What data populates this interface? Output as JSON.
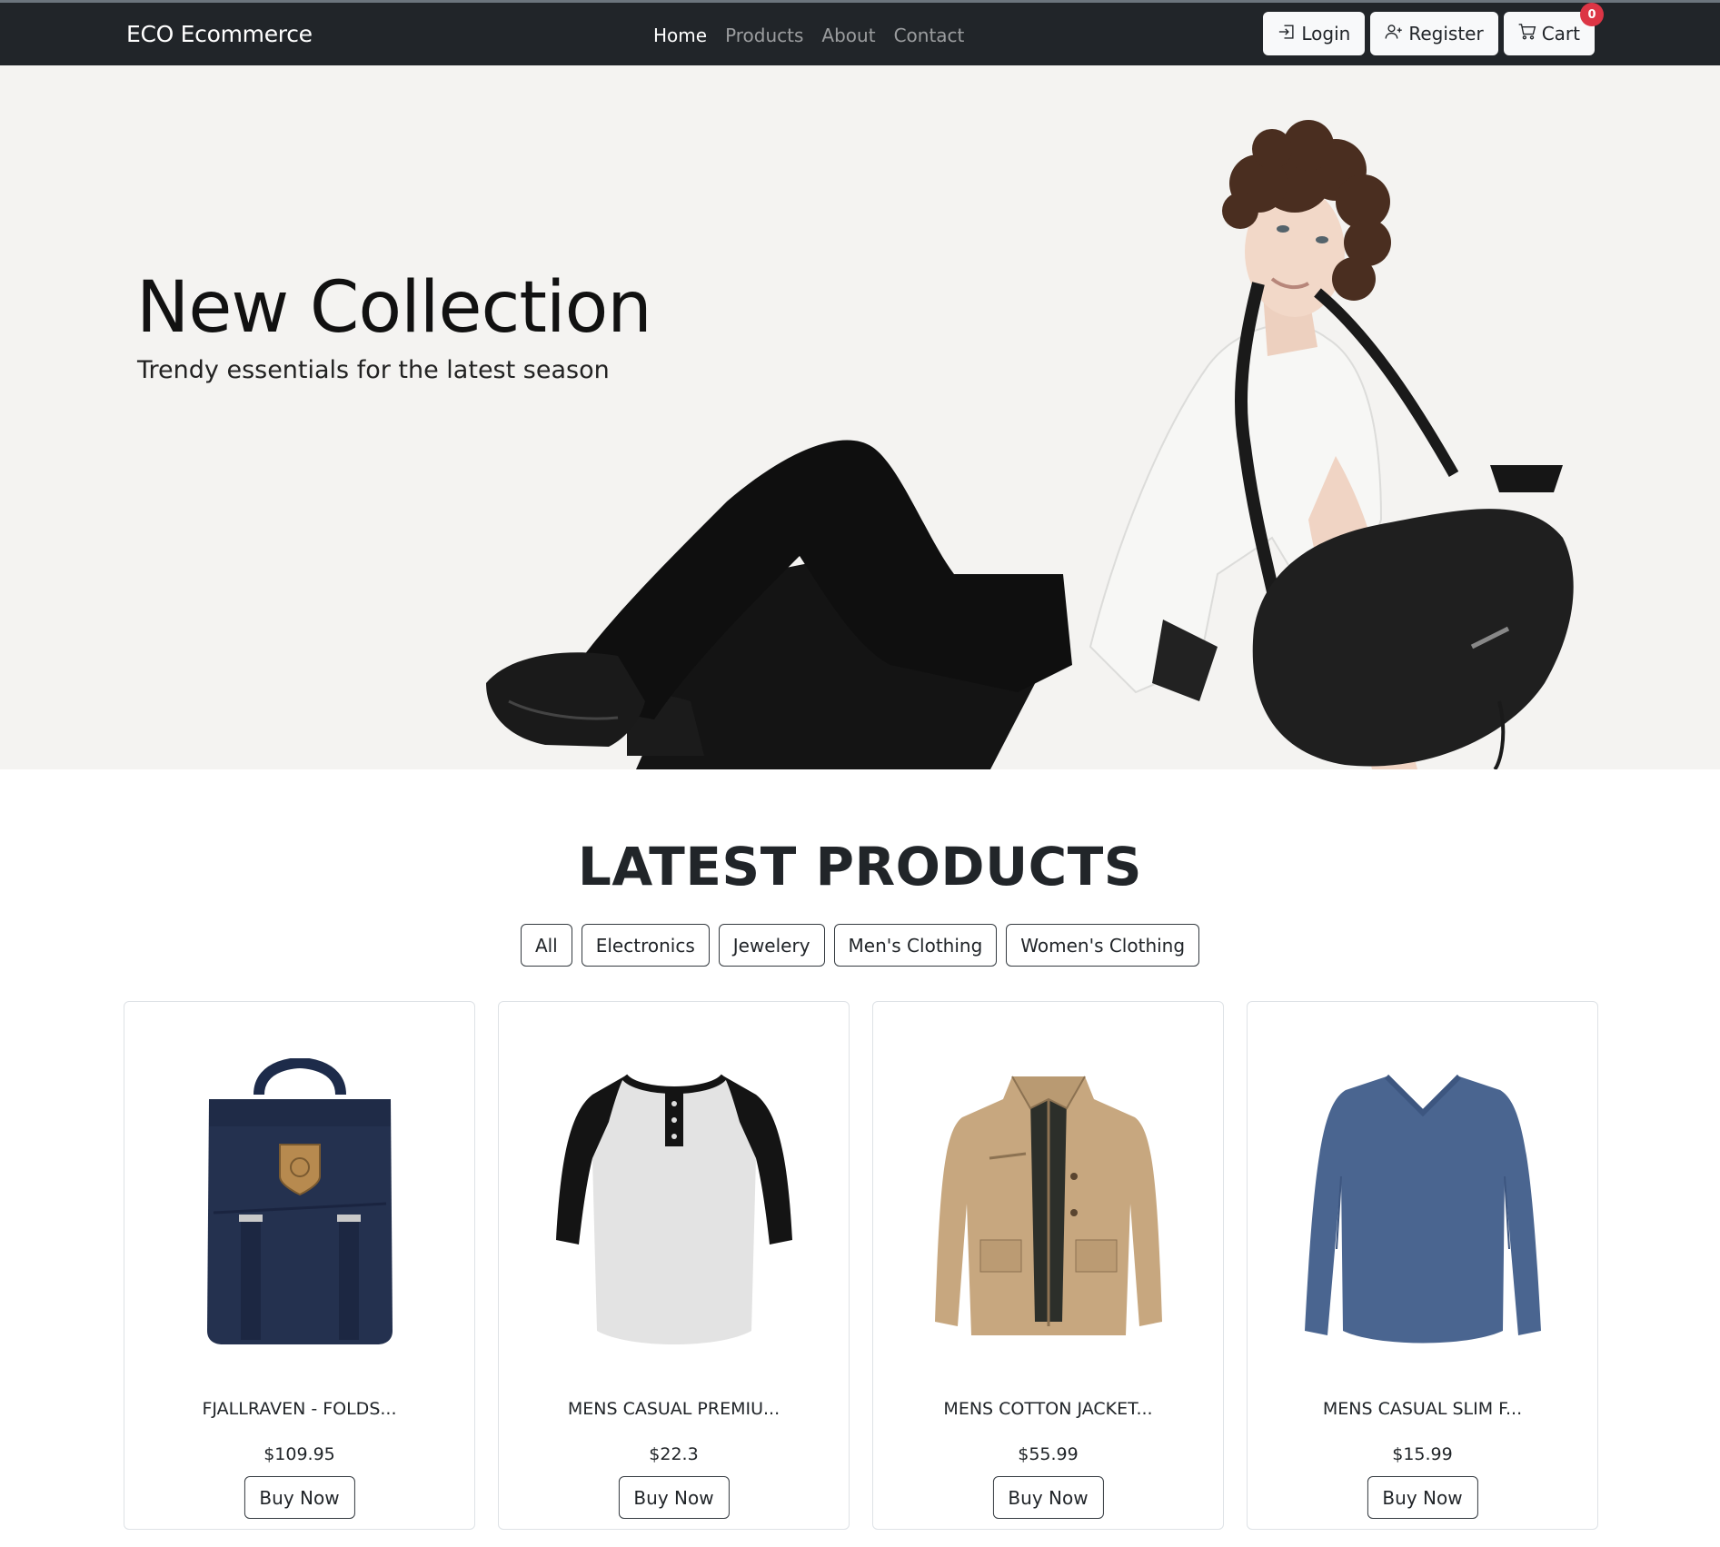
{
  "navbar": {
    "brand": "ECO Ecommerce",
    "links": [
      {
        "label": "Home",
        "active": true
      },
      {
        "label": "Products",
        "active": false
      },
      {
        "label": "About",
        "active": false
      },
      {
        "label": "Contact",
        "active": false
      }
    ],
    "login_label": "Login",
    "register_label": "Register",
    "cart_label": "Cart",
    "cart_count": "0"
  },
  "hero": {
    "title": "New Collection",
    "subtitle": "Trendy essentials for the latest season"
  },
  "products_section": {
    "title": "LATEST PRODUCTS",
    "filters": [
      "All",
      "Electronics",
      "Jewelery",
      "Men's Clothing",
      "Women's Clothing"
    ],
    "buy_label": "Buy Now",
    "items": [
      {
        "title": "FJALLRAVEN - FOLDS...",
        "price": "$109.95",
        "icon": "backpack"
      },
      {
        "title": "MENS CASUAL PREMIU...",
        "price": "$22.3",
        "icon": "raglan-tshirt"
      },
      {
        "title": "MENS COTTON JACKET...",
        "price": "$55.99",
        "icon": "jacket"
      },
      {
        "title": "MENS CASUAL SLIM F...",
        "price": "$15.99",
        "icon": "longsleeve-shirt"
      }
    ]
  },
  "colors": {
    "navbar_bg": "#212529",
    "hero_bg": "#f4f3f1",
    "badge": "#dc3545"
  }
}
